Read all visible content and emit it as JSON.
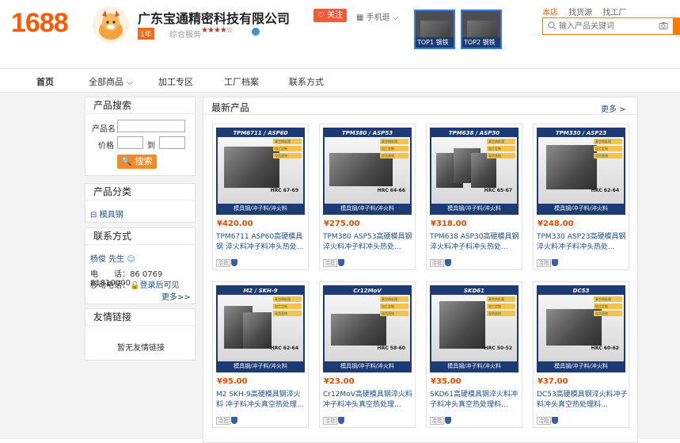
{
  "header": {
    "logo": "1688",
    "company_name": "广东宝通精密科技有限公司",
    "year_badge": "1年",
    "service_label": "综合服务",
    "stars": "★★★★☆",
    "follow_label": "关注",
    "mobile_label": "手机逛",
    "top_products": [
      {
        "tag": "TOP1 钢铁"
      },
      {
        "tag": "TOP2 钢铁"
      }
    ],
    "top_links": [
      "本店",
      "找货源",
      "找工厂"
    ],
    "search_placeholder": "输入产品关键词"
  },
  "nav": {
    "items": [
      "首页",
      "全部商品",
      "加工专区",
      "工厂档案",
      "联系方式"
    ]
  },
  "sidebar": {
    "product_search": {
      "title": "产品搜索",
      "name_label": "产品名",
      "price_label": "价格",
      "to_label": "到",
      "search_button": "搜索"
    },
    "categories": {
      "title": "产品分类",
      "items": [
        "模具钢"
      ]
    },
    "contact": {
      "title": "联系方式",
      "name": "杨俊 先生",
      "phone_label": "电　　话：",
      "phone": "86 0769 81810000",
      "mobile_label": "移动电话：",
      "mobile_value": "登录后可见",
      "more": "更多>>"
    },
    "friend_links": {
      "title": "友情链接",
      "empty": "暂无友情链接"
    }
  },
  "main": {
    "title": "最新产品",
    "more": "更多 >",
    "products": [
      {
        "banner": "TPM6711 / ASP60",
        "hrc": "HRC 67-69",
        "footer": "模具钢/冲子料/淬火料",
        "price": "¥420.00",
        "name": "TPM6711 ASP60高硬模具钢 淬火料冲子料冲头热处...",
        "chat": "洽批"
      },
      {
        "banner": "TPM380 / ASP53",
        "hrc": "HRC 64-66",
        "footer": "模具钢/冲子料/淬火料",
        "price": "¥275.00",
        "name": "TPM380 ASP53高硬模具钢 淬火料冲子料冲头热处...",
        "chat": "洽批"
      },
      {
        "banner": "TPM638 / ASP30",
        "hrc": "HRC 65-67",
        "footer": "模具钢/冲子料/淬火料",
        "price": "¥318.00",
        "name": "TPM638 ASP30高硬模具钢 淬火料冲子料冲头热处...",
        "chat": "洽批"
      },
      {
        "banner": "TPM330 / ASP23",
        "hrc": "HRC 62-64",
        "footer": "模具钢/冲子料/淬火料",
        "price": "¥248.00",
        "name": "TPM330 ASP23高硬模具钢 淬火料冲子料冲头热处...",
        "chat": "洽批"
      },
      {
        "banner": "M2 / SKH-9",
        "hrc": "HRC 62-64",
        "footer": "模具钢/冲子料/淬火料",
        "price": "¥95.00",
        "name": "M2 SKH-9高硬模具钢淬火料 冲子料冲头真空热处理...",
        "chat": "洽批"
      },
      {
        "banner": "Cr12MoV",
        "hrc": "HRC 58-60",
        "footer": "模具钢/冲子料/淬火料",
        "price": "¥23.00",
        "name": "Cr12MoV高硬模具钢淬火料 冲子料冲头真空热处理...",
        "chat": "洽批"
      },
      {
        "banner": "SKD61",
        "hrc": "HRC 50-52",
        "footer": "模具钢/冲子料/淬火料",
        "price": "¥35.00",
        "name": "SKD61高硬模具钢淬火料冲 子料冲头真空热处理料...",
        "chat": "洽批"
      },
      {
        "banner": "DC53",
        "hrc": "HRC 60-62",
        "footer": "模具钢/冲子料/淬火料",
        "price": "¥37.00",
        "name": "DC53高硬模具钢淬火料冲子 料冲头真空热处理料...",
        "chat": "洽批"
      }
    ],
    "check_labels": [
      "真空热处理",
      "加工定制",
      "现货直销"
    ]
  },
  "colors": {
    "brand_orange": "#ff5a00",
    "price_orange": "#e84a00",
    "link_blue": "#1b4d8f",
    "banner_navy": "#1c3a73"
  }
}
